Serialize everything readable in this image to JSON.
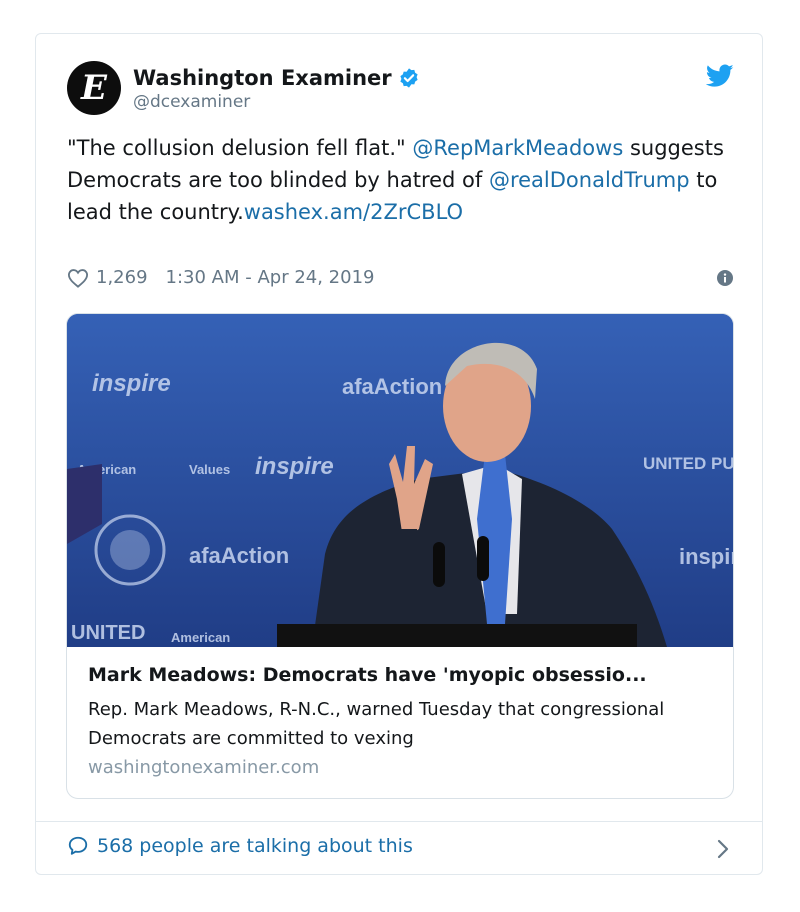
{
  "tweet": {
    "author_name": "Washington Examiner",
    "handle": "@dcexaminer",
    "avatar_letter": "E",
    "text_parts": {
      "quote": "\"The collusion delusion fell flat.\" ",
      "mention1": "@RepMarkMeadows",
      "mid1": " suggests Democrats are too blinded by hatred of ",
      "mention2": "@realDonaldTrump",
      "mid2": " to lead the country.",
      "link": "washex.am/2ZrCBLO"
    },
    "likes": "1,269",
    "timestamp": "1:30 AM - Apr 24, 2019"
  },
  "link_card": {
    "title": "Mark Meadows: Democrats have 'myopic obsessio...",
    "description": "Rep. Mark Meadows, R-N.C., warned Tuesday that congressional Democrats are committed to vexing",
    "domain": "washingtonexaminer.com",
    "backdrop_words": [
      "inspire",
      "afaAction",
      "inspire",
      "afaAction",
      "UNITED",
      "American",
      "Values",
      "UNITED PURPOSE",
      "inspir",
      "American"
    ]
  },
  "footer": {
    "talking": "568 people are talking about this"
  },
  "icons": [
    "verified-badge-icon",
    "twitter-bird-icon",
    "heart-icon",
    "info-icon",
    "speech-bubble-icon",
    "chevron-right-icon"
  ],
  "colors": {
    "link": "#1b6ea8",
    "muted": "#657786",
    "verified": "#1da1f2",
    "backdrop": "#2f5ab0"
  }
}
